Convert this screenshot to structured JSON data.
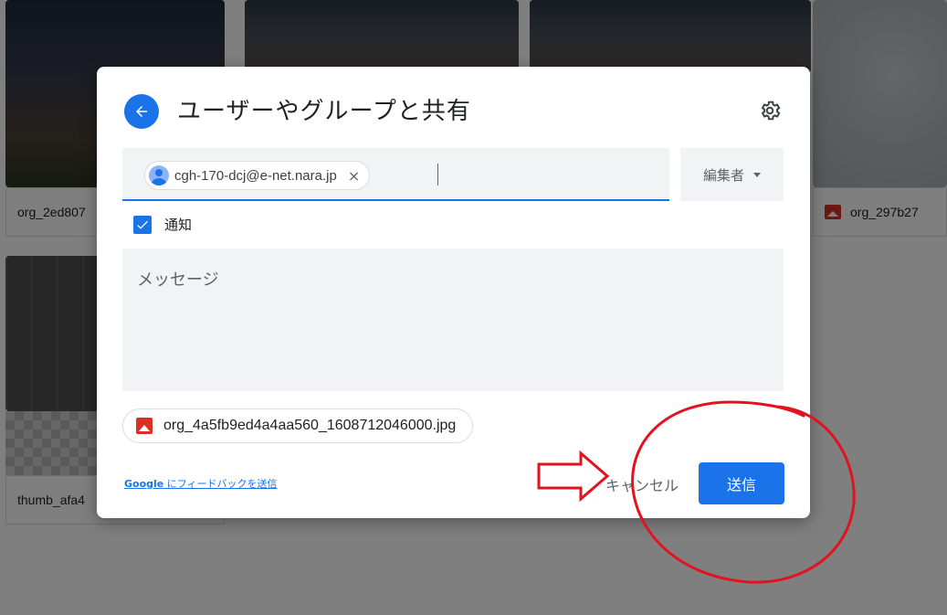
{
  "background": {
    "files": [
      {
        "name": "org_2ed807",
        "has_icon": false
      },
      {
        "name": "org_297b27",
        "has_icon": true
      },
      {
        "name": "thumb_afa4",
        "has_icon": false
      }
    ]
  },
  "dialog": {
    "title": "ユーザーやグループと共有",
    "back_icon": "arrow-back-icon",
    "settings_icon": "gear-icon",
    "recipient": {
      "email": "cgh-170-dcj@e-net.nara.jp",
      "remove_glyph": "×"
    },
    "role": {
      "selected": "編集者"
    },
    "notify": {
      "label": "通知",
      "checked": true
    },
    "message": {
      "placeholder": "メッセージ"
    },
    "attachment": {
      "file_name": "org_4a5fb9ed4a4aa560_1608712046000.jpg"
    },
    "footer": {
      "feedback_brand": "Google",
      "feedback_text": " にフィードバックを送信",
      "cancel_label": "キャンセル",
      "send_label": "送信"
    }
  },
  "colors": {
    "accent": "#1a73e8",
    "annotation": "#e0131f",
    "file_icon": "#d93025"
  }
}
